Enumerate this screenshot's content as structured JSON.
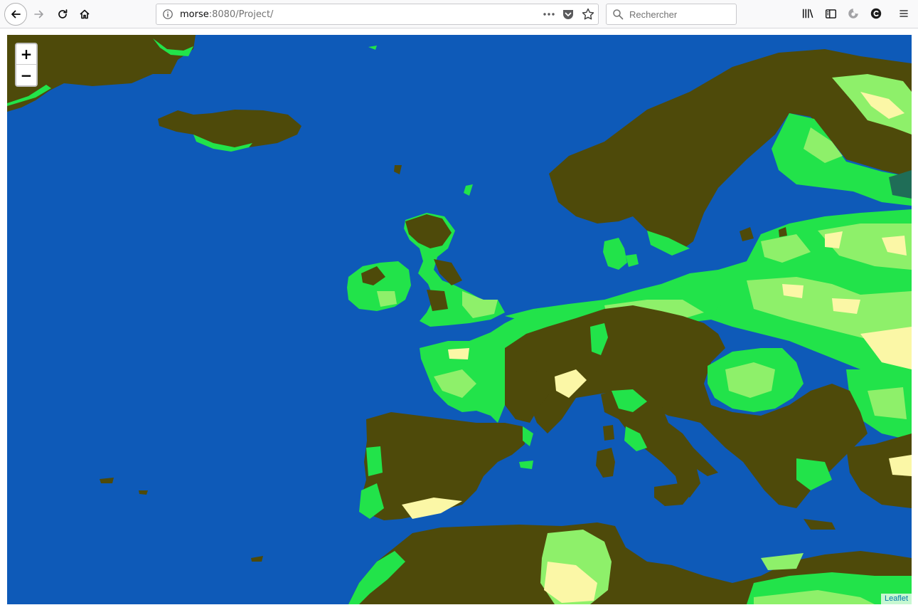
{
  "browser": {
    "url_host": "morse",
    "url_path": ":8080/Project/",
    "search_placeholder": "Rechercher"
  },
  "map": {
    "zoom_in_label": "+",
    "zoom_out_label": "−",
    "attribution": "Leaflet",
    "colors": {
      "sea": "#0e5ab8",
      "highland": "#4e4a0a",
      "lowland_green": "#22e34a",
      "mid_green": "#8ef06a",
      "light": "#fbf7a6",
      "attribution_link": "#0078a8"
    }
  }
}
